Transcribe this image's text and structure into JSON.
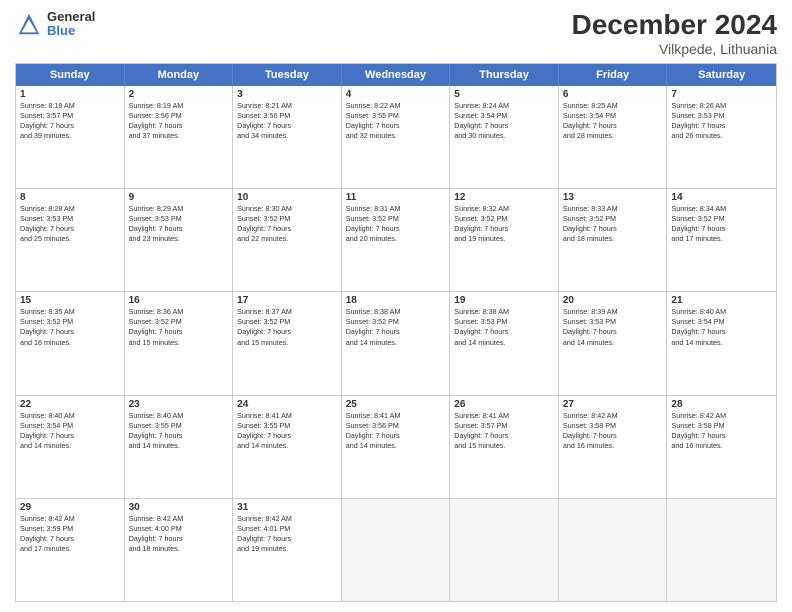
{
  "header": {
    "logo_general": "General",
    "logo_blue": "Blue",
    "title": "December 2024",
    "subtitle": "Vilkpede, Lithuania"
  },
  "days_of_week": [
    "Sunday",
    "Monday",
    "Tuesday",
    "Wednesday",
    "Thursday",
    "Friday",
    "Saturday"
  ],
  "rows": [
    [
      {
        "day": "1",
        "lines": [
          "Sunrise: 8:18 AM",
          "Sunset: 3:57 PM",
          "Daylight: 7 hours",
          "and 39 minutes."
        ]
      },
      {
        "day": "2",
        "lines": [
          "Sunrise: 8:19 AM",
          "Sunset: 3:56 PM",
          "Daylight: 7 hours",
          "and 37 minutes."
        ]
      },
      {
        "day": "3",
        "lines": [
          "Sunrise: 8:21 AM",
          "Sunset: 3:56 PM",
          "Daylight: 7 hours",
          "and 34 minutes."
        ]
      },
      {
        "day": "4",
        "lines": [
          "Sunrise: 8:22 AM",
          "Sunset: 3:55 PM",
          "Daylight: 7 hours",
          "and 32 minutes."
        ]
      },
      {
        "day": "5",
        "lines": [
          "Sunrise: 8:24 AM",
          "Sunset: 3:54 PM",
          "Daylight: 7 hours",
          "and 30 minutes."
        ]
      },
      {
        "day": "6",
        "lines": [
          "Sunrise: 8:25 AM",
          "Sunset: 3:54 PM",
          "Daylight: 7 hours",
          "and 28 minutes."
        ]
      },
      {
        "day": "7",
        "lines": [
          "Sunrise: 8:26 AM",
          "Sunset: 3:53 PM",
          "Daylight: 7 hours",
          "and 26 minutes."
        ]
      }
    ],
    [
      {
        "day": "8",
        "lines": [
          "Sunrise: 8:28 AM",
          "Sunset: 3:53 PM",
          "Daylight: 7 hours",
          "and 25 minutes."
        ]
      },
      {
        "day": "9",
        "lines": [
          "Sunrise: 8:29 AM",
          "Sunset: 3:53 PM",
          "Daylight: 7 hours",
          "and 23 minutes."
        ]
      },
      {
        "day": "10",
        "lines": [
          "Sunrise: 8:30 AM",
          "Sunset: 3:52 PM",
          "Daylight: 7 hours",
          "and 22 minutes."
        ]
      },
      {
        "day": "11",
        "lines": [
          "Sunrise: 8:31 AM",
          "Sunset: 3:52 PM",
          "Daylight: 7 hours",
          "and 20 minutes."
        ]
      },
      {
        "day": "12",
        "lines": [
          "Sunrise: 8:32 AM",
          "Sunset: 3:52 PM",
          "Daylight: 7 hours",
          "and 19 minutes."
        ]
      },
      {
        "day": "13",
        "lines": [
          "Sunrise: 8:33 AM",
          "Sunset: 3:52 PM",
          "Daylight: 7 hours",
          "and 18 minutes."
        ]
      },
      {
        "day": "14",
        "lines": [
          "Sunrise: 8:34 AM",
          "Sunset: 3:52 PM",
          "Daylight: 7 hours",
          "and 17 minutes."
        ]
      }
    ],
    [
      {
        "day": "15",
        "lines": [
          "Sunrise: 8:35 AM",
          "Sunset: 3:52 PM",
          "Daylight: 7 hours",
          "and 16 minutes."
        ]
      },
      {
        "day": "16",
        "lines": [
          "Sunrise: 8:36 AM",
          "Sunset: 3:52 PM",
          "Daylight: 7 hours",
          "and 15 minutes."
        ]
      },
      {
        "day": "17",
        "lines": [
          "Sunrise: 8:37 AM",
          "Sunset: 3:52 PM",
          "Daylight: 7 hours",
          "and 15 minutes."
        ]
      },
      {
        "day": "18",
        "lines": [
          "Sunrise: 8:38 AM",
          "Sunset: 3:52 PM",
          "Daylight: 7 hours",
          "and 14 minutes."
        ]
      },
      {
        "day": "19",
        "lines": [
          "Sunrise: 8:38 AM",
          "Sunset: 3:53 PM",
          "Daylight: 7 hours",
          "and 14 minutes."
        ]
      },
      {
        "day": "20",
        "lines": [
          "Sunrise: 8:39 AM",
          "Sunset: 3:53 PM",
          "Daylight: 7 hours",
          "and 14 minutes."
        ]
      },
      {
        "day": "21",
        "lines": [
          "Sunrise: 8:40 AM",
          "Sunset: 3:54 PM",
          "Daylight: 7 hours",
          "and 14 minutes."
        ]
      }
    ],
    [
      {
        "day": "22",
        "lines": [
          "Sunrise: 8:40 AM",
          "Sunset: 3:54 PM",
          "Daylight: 7 hours",
          "and 14 minutes."
        ]
      },
      {
        "day": "23",
        "lines": [
          "Sunrise: 8:40 AM",
          "Sunset: 3:55 PM",
          "Daylight: 7 hours",
          "and 14 minutes."
        ]
      },
      {
        "day": "24",
        "lines": [
          "Sunrise: 8:41 AM",
          "Sunset: 3:55 PM",
          "Daylight: 7 hours",
          "and 14 minutes."
        ]
      },
      {
        "day": "25",
        "lines": [
          "Sunrise: 8:41 AM",
          "Sunset: 3:56 PM",
          "Daylight: 7 hours",
          "and 14 minutes."
        ]
      },
      {
        "day": "26",
        "lines": [
          "Sunrise: 8:41 AM",
          "Sunset: 3:57 PM",
          "Daylight: 7 hours",
          "and 15 minutes."
        ]
      },
      {
        "day": "27",
        "lines": [
          "Sunrise: 8:42 AM",
          "Sunset: 3:58 PM",
          "Daylight: 7 hours",
          "and 16 minutes."
        ]
      },
      {
        "day": "28",
        "lines": [
          "Sunrise: 8:42 AM",
          "Sunset: 3:58 PM",
          "Daylight: 7 hours",
          "and 16 minutes."
        ]
      }
    ],
    [
      {
        "day": "29",
        "lines": [
          "Sunrise: 8:42 AM",
          "Sunset: 3:59 PM",
          "Daylight: 7 hours",
          "and 17 minutes."
        ]
      },
      {
        "day": "30",
        "lines": [
          "Sunrise: 8:42 AM",
          "Sunset: 4:00 PM",
          "Daylight: 7 hours",
          "and 18 minutes."
        ]
      },
      {
        "day": "31",
        "lines": [
          "Sunrise: 8:42 AM",
          "Sunset: 4:01 PM",
          "Daylight: 7 hours",
          "and 19 minutes."
        ]
      },
      {
        "day": "",
        "lines": []
      },
      {
        "day": "",
        "lines": []
      },
      {
        "day": "",
        "lines": []
      },
      {
        "day": "",
        "lines": []
      }
    ]
  ]
}
